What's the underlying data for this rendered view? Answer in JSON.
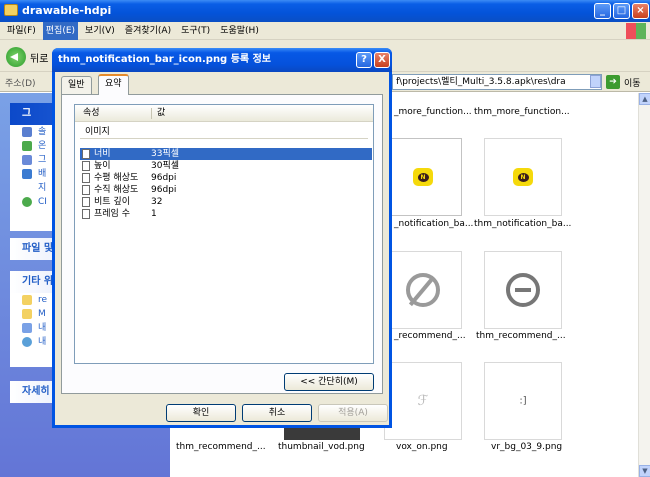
{
  "explorer": {
    "title": "drawable-hdpi",
    "menu": [
      "파일(F)",
      "편집(E)",
      "보기(V)",
      "즐겨찾기(A)",
      "도구(T)",
      "도움말(H)"
    ],
    "active_menu_index": 1,
    "back_label": "뒤로",
    "address_label": "주소(D)",
    "address_path": "f\\projects\\멜티_Multi_3.5.8.apk\\res\\dra",
    "go_label": "이동",
    "left_pane": {
      "box1_head": "그",
      "box1_items": [
        "솔",
        "온",
        "그",
        "배",
        "지",
        "CI"
      ],
      "box2_head": "파일 및",
      "box3_head": "기타 위",
      "box3_items": [
        "re",
        "M",
        "내",
        "내"
      ],
      "box4_head": "자세히"
    },
    "files": [
      {
        "label": "_more_function..."
      },
      {
        "label": "thm_more_function..."
      },
      {
        "label": "_notification_ba..."
      },
      {
        "label": "thm_notification_ba..."
      },
      {
        "label": "_recommend_..."
      },
      {
        "label": "thm_recommend_..."
      },
      {
        "label": "thm_recommend_..."
      },
      {
        "label": "thumbnail_vod.png"
      },
      {
        "label": "vox_on.png"
      },
      {
        "label": "vr_bg_03_9.png"
      }
    ]
  },
  "dialog": {
    "title": "thm_notification_bar_icon.png 등록 정보",
    "help": "?",
    "close": "X",
    "tabs": [
      "일반",
      "요약"
    ],
    "active_tab": 1,
    "columns": [
      "속성",
      "값"
    ],
    "section": "이미지",
    "rows": [
      {
        "prop": "너비",
        "val": "33픽셀",
        "selected": true
      },
      {
        "prop": "높이",
        "val": "30픽셀"
      },
      {
        "prop": "수평 해상도",
        "val": "96dpi"
      },
      {
        "prop": "수직 해상도",
        "val": "96dpi"
      },
      {
        "prop": "비트 깊이",
        "val": "32"
      },
      {
        "prop": "프레임 수",
        "val": "1"
      }
    ],
    "simple_button": "<< 간단히(M)",
    "ok": "확인",
    "cancel": "취소",
    "apply": "적용(A)"
  }
}
